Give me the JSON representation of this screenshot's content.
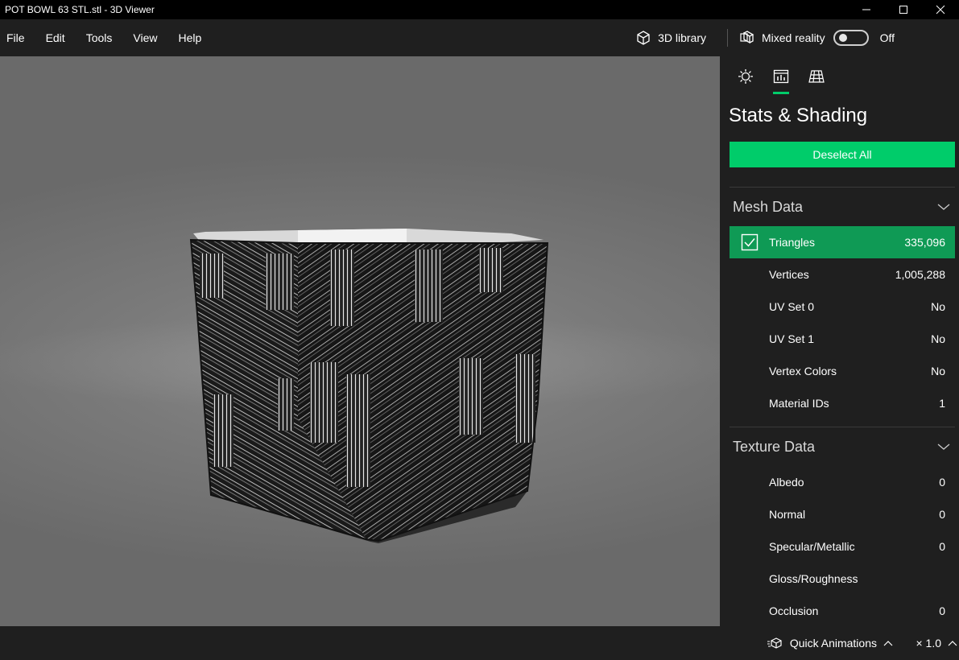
{
  "window": {
    "title": "POT BOWL 63 STL.stl - 3D Viewer"
  },
  "menu": {
    "items": [
      "File",
      "Edit",
      "Tools",
      "View",
      "Help"
    ]
  },
  "toolbar": {
    "library_label": "3D library",
    "mixed_reality_label": "Mixed reality",
    "mixed_reality_state": "Off"
  },
  "panel": {
    "title": "Stats & Shading",
    "deselect_label": "Deselect All",
    "mesh": {
      "header": "Mesh Data",
      "rows": [
        {
          "name": "Triangles",
          "value": "335,096",
          "checked": true
        },
        {
          "name": "Vertices",
          "value": "1,005,288"
        },
        {
          "name": "UV Set 0",
          "value": "No"
        },
        {
          "name": "UV Set 1",
          "value": "No"
        },
        {
          "name": "Vertex Colors",
          "value": "No"
        },
        {
          "name": "Material IDs",
          "value": "1"
        }
      ]
    },
    "texture": {
      "header": "Texture Data",
      "rows": [
        {
          "name": "Albedo",
          "value": "0"
        },
        {
          "name": "Normal",
          "value": "0"
        },
        {
          "name": "Specular/Metallic",
          "value": "0"
        },
        {
          "name": "Gloss/Roughness",
          "value": ""
        },
        {
          "name": "Occlusion",
          "value": "0"
        }
      ]
    }
  },
  "statusbar": {
    "quick_animations_label": "Quick Animations",
    "speed_label": "× 1.0"
  },
  "colors": {
    "accent": "#00cc6a",
    "selected_row": "#0f9a55",
    "background": "#1f1f1f",
    "titlebar": "#000000"
  }
}
